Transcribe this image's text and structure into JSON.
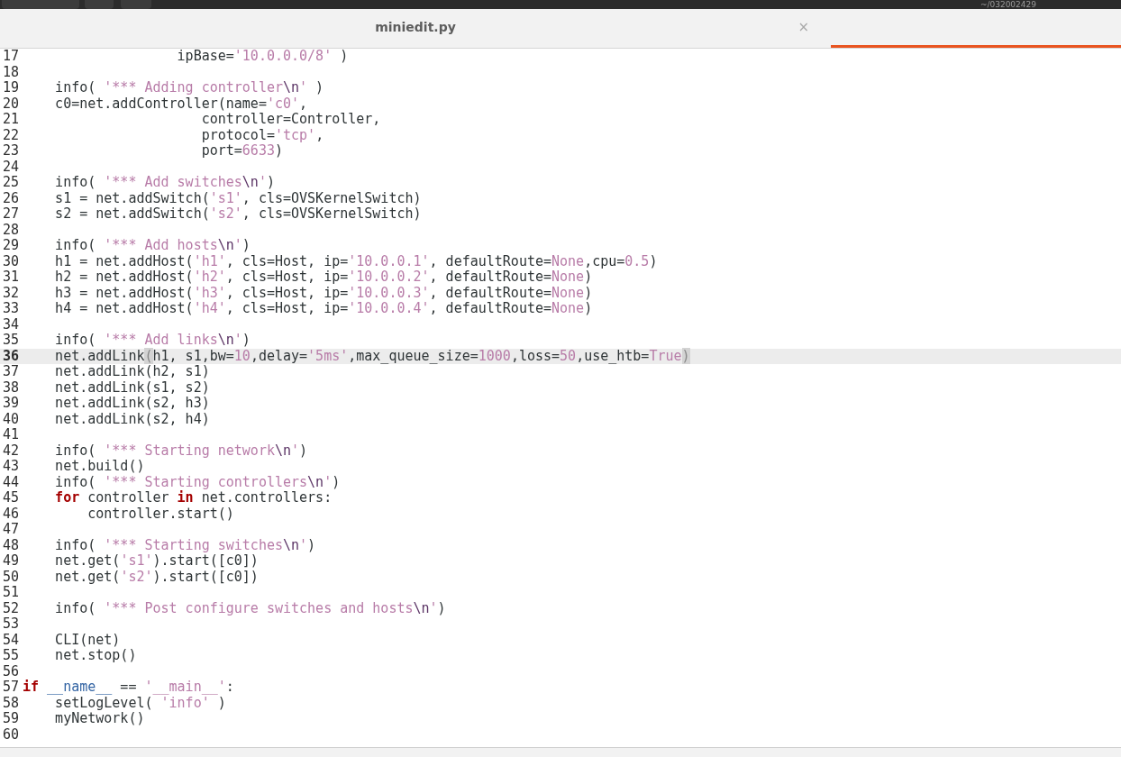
{
  "header": {
    "path": "~/032002429"
  },
  "tabs": [
    {
      "label": "miniedit.py",
      "selected": false,
      "close": "×"
    },
    {
      "selected": true
    }
  ],
  "lines": [
    {
      "number": "17",
      "current": false,
      "tokens": [
        {
          "kind": "plain",
          "text": "                   ipBase="
        },
        {
          "kind": "str",
          "text": "'10.0.0.0/8'"
        },
        {
          "kind": "plain",
          "text": " )"
        }
      ]
    },
    {
      "number": "18",
      "current": false
    },
    {
      "number": "19",
      "current": false,
      "tokens": [
        {
          "kind": "plain",
          "text": "    info( "
        },
        {
          "kind": "str",
          "text": "'*** Adding controller"
        },
        {
          "kind": "esc",
          "text": "\\n"
        },
        {
          "kind": "str",
          "text": "'"
        },
        {
          "kind": "plain",
          "text": " )"
        }
      ]
    },
    {
      "number": "20",
      "current": false,
      "tokens": [
        {
          "kind": "plain",
          "text": "    c0=net.addController(name="
        },
        {
          "kind": "str",
          "text": "'c0'"
        },
        {
          "kind": "plain",
          "text": ","
        }
      ]
    },
    {
      "number": "21",
      "current": false,
      "tokens": [
        {
          "kind": "plain",
          "text": "                      controller=Controller,"
        }
      ]
    },
    {
      "number": "22",
      "current": false,
      "tokens": [
        {
          "kind": "plain",
          "text": "                      protocol="
        },
        {
          "kind": "str",
          "text": "'tcp'"
        },
        {
          "kind": "plain",
          "text": ","
        }
      ]
    },
    {
      "number": "23",
      "current": false,
      "tokens": [
        {
          "kind": "plain",
          "text": "                      port="
        },
        {
          "kind": "num",
          "text": "6633"
        },
        {
          "kind": "plain",
          "text": ")"
        }
      ]
    },
    {
      "number": "24",
      "current": false
    },
    {
      "number": "25",
      "current": false,
      "tokens": [
        {
          "kind": "plain",
          "text": "    info( "
        },
        {
          "kind": "str",
          "text": "'*** Add switches"
        },
        {
          "kind": "esc",
          "text": "\\n"
        },
        {
          "kind": "str",
          "text": "'"
        },
        {
          "kind": "plain",
          "text": ")"
        }
      ]
    },
    {
      "number": "26",
      "current": false,
      "tokens": [
        {
          "kind": "plain",
          "text": "    s1 = net.addSwitch("
        },
        {
          "kind": "str",
          "text": "'s1'"
        },
        {
          "kind": "plain",
          "text": ", cls=OVSKernelSwitch)"
        }
      ]
    },
    {
      "number": "27",
      "current": false,
      "tokens": [
        {
          "kind": "plain",
          "text": "    s2 = net.addSwitch("
        },
        {
          "kind": "str",
          "text": "'s2'"
        },
        {
          "kind": "plain",
          "text": ", cls=OVSKernelSwitch)"
        }
      ]
    },
    {
      "number": "28",
      "current": false
    },
    {
      "number": "29",
      "current": false,
      "tokens": [
        {
          "kind": "plain",
          "text": "    info( "
        },
        {
          "kind": "str",
          "text": "'*** Add hosts"
        },
        {
          "kind": "esc",
          "text": "\\n"
        },
        {
          "kind": "str",
          "text": "'"
        },
        {
          "kind": "plain",
          "text": ")"
        }
      ]
    },
    {
      "number": "30",
      "current": false,
      "tokens": [
        {
          "kind": "plain",
          "text": "    h1 = net.addHost("
        },
        {
          "kind": "str",
          "text": "'h1'"
        },
        {
          "kind": "plain",
          "text": ", cls=Host, ip="
        },
        {
          "kind": "str",
          "text": "'10.0.0.1'"
        },
        {
          "kind": "plain",
          "text": ", defaultRoute="
        },
        {
          "kind": "num",
          "text": "None"
        },
        {
          "kind": "plain",
          "text": ",cpu="
        },
        {
          "kind": "num",
          "text": "0.5"
        },
        {
          "kind": "plain",
          "text": ")"
        }
      ]
    },
    {
      "number": "31",
      "current": false,
      "tokens": [
        {
          "kind": "plain",
          "text": "    h2 = net.addHost("
        },
        {
          "kind": "str",
          "text": "'h2'"
        },
        {
          "kind": "plain",
          "text": ", cls=Host, ip="
        },
        {
          "kind": "str",
          "text": "'10.0.0.2'"
        },
        {
          "kind": "plain",
          "text": ", defaultRoute="
        },
        {
          "kind": "num",
          "text": "None"
        },
        {
          "kind": "plain",
          "text": ")"
        }
      ]
    },
    {
      "number": "32",
      "current": false,
      "tokens": [
        {
          "kind": "plain",
          "text": "    h3 = net.addHost("
        },
        {
          "kind": "str",
          "text": "'h3'"
        },
        {
          "kind": "plain",
          "text": ", cls=Host, ip="
        },
        {
          "kind": "str",
          "text": "'10.0.0.3'"
        },
        {
          "kind": "plain",
          "text": ", defaultRoute="
        },
        {
          "kind": "num",
          "text": "None"
        },
        {
          "kind": "plain",
          "text": ")"
        }
      ]
    },
    {
      "number": "33",
      "current": false,
      "tokens": [
        {
          "kind": "plain",
          "text": "    h4 = net.addHost("
        },
        {
          "kind": "str",
          "text": "'h4'"
        },
        {
          "kind": "plain",
          "text": ", cls=Host, ip="
        },
        {
          "kind": "str",
          "text": "'10.0.0.4'"
        },
        {
          "kind": "plain",
          "text": ", defaultRoute="
        },
        {
          "kind": "num",
          "text": "None"
        },
        {
          "kind": "plain",
          "text": ")"
        }
      ]
    },
    {
      "number": "34",
      "current": false
    },
    {
      "number": "35",
      "current": false,
      "tokens": [
        {
          "kind": "plain",
          "text": "    info( "
        },
        {
          "kind": "str",
          "text": "'*** Add links"
        },
        {
          "kind": "esc",
          "text": "\\n"
        },
        {
          "kind": "str",
          "text": "'"
        },
        {
          "kind": "plain",
          "text": ")"
        }
      ]
    },
    {
      "number": "36",
      "current": true,
      "tokens": [
        {
          "kind": "plain",
          "text": "    net.addLink"
        },
        {
          "kind": "match",
          "text": "("
        },
        {
          "kind": "plain",
          "text": "h1, s1,bw="
        },
        {
          "kind": "num",
          "text": "10"
        },
        {
          "kind": "plain",
          "text": ",delay="
        },
        {
          "kind": "str",
          "text": "'5ms'"
        },
        {
          "kind": "plain",
          "text": ",max_queue_size="
        },
        {
          "kind": "num",
          "text": "1000"
        },
        {
          "kind": "plain",
          "text": ",loss="
        },
        {
          "kind": "num",
          "text": "50"
        },
        {
          "kind": "plain",
          "text": ",use_htb="
        },
        {
          "kind": "num",
          "text": "True"
        },
        {
          "kind": "match",
          "text": ")"
        }
      ]
    },
    {
      "number": "37",
      "current": false,
      "tokens": [
        {
          "kind": "plain",
          "text": "    net.addLink(h2, s1)"
        }
      ]
    },
    {
      "number": "38",
      "current": false,
      "tokens": [
        {
          "kind": "plain",
          "text": "    net.addLink(s1, s2)"
        }
      ]
    },
    {
      "number": "39",
      "current": false,
      "tokens": [
        {
          "kind": "plain",
          "text": "    net.addLink(s2, h3)"
        }
      ]
    },
    {
      "number": "40",
      "current": false,
      "tokens": [
        {
          "kind": "plain",
          "text": "    net.addLink(s2, h4)"
        }
      ]
    },
    {
      "number": "41",
      "current": false
    },
    {
      "number": "42",
      "current": false,
      "tokens": [
        {
          "kind": "plain",
          "text": "    info( "
        },
        {
          "kind": "str",
          "text": "'*** Starting network"
        },
        {
          "kind": "esc",
          "text": "\\n"
        },
        {
          "kind": "str",
          "text": "'"
        },
        {
          "kind": "plain",
          "text": ")"
        }
      ]
    },
    {
      "number": "43",
      "current": false,
      "tokens": [
        {
          "kind": "plain",
          "text": "    net.build()"
        }
      ]
    },
    {
      "number": "44",
      "current": false,
      "tokens": [
        {
          "kind": "plain",
          "text": "    info( "
        },
        {
          "kind": "str",
          "text": "'*** Starting controllers"
        },
        {
          "kind": "esc",
          "text": "\\n"
        },
        {
          "kind": "str",
          "text": "'"
        },
        {
          "kind": "plain",
          "text": ")"
        }
      ]
    },
    {
      "number": "45",
      "current": false,
      "indented": true,
      "tokens": [
        {
          "kind": "kw",
          "text": "for"
        },
        {
          "kind": "plain",
          "text": " controller "
        },
        {
          "kind": "kw",
          "text": "in"
        },
        {
          "kind": "plain",
          "text": " net.controllers:"
        }
      ]
    },
    {
      "number": "46",
      "current": false,
      "tokens": [
        {
          "kind": "plain",
          "text": "        controller.start()"
        }
      ]
    },
    {
      "number": "47",
      "current": false
    },
    {
      "number": "48",
      "current": false,
      "tokens": [
        {
          "kind": "plain",
          "text": "    info( "
        },
        {
          "kind": "str",
          "text": "'*** Starting switches"
        },
        {
          "kind": "esc",
          "text": "\\n"
        },
        {
          "kind": "str",
          "text": "'"
        },
        {
          "kind": "plain",
          "text": ")"
        }
      ]
    },
    {
      "number": "49",
      "current": false,
      "tokens": [
        {
          "kind": "plain",
          "text": "    net.get("
        },
        {
          "kind": "str",
          "text": "'s1'"
        },
        {
          "kind": "plain",
          "text": ").start([c0])"
        }
      ]
    },
    {
      "number": "50",
      "current": false,
      "tokens": [
        {
          "kind": "plain",
          "text": "    net.get("
        },
        {
          "kind": "str",
          "text": "'s2'"
        },
        {
          "kind": "plain",
          "text": ").start([c0])"
        }
      ]
    },
    {
      "number": "51",
      "current": false
    },
    {
      "number": "52",
      "current": false,
      "tokens": [
        {
          "kind": "plain",
          "text": "    info( "
        },
        {
          "kind": "str",
          "text": "'*** Post configure switches and hosts"
        },
        {
          "kind": "esc",
          "text": "\\n"
        },
        {
          "kind": "str",
          "text": "'"
        },
        {
          "kind": "plain",
          "text": ")"
        }
      ]
    },
    {
      "number": "53",
      "current": false
    },
    {
      "number": "54",
      "current": false,
      "tokens": [
        {
          "kind": "plain",
          "text": "    CLI(net)"
        }
      ]
    },
    {
      "number": "55",
      "current": false,
      "tokens": [
        {
          "kind": "plain",
          "text": "    net.stop()"
        }
      ]
    },
    {
      "number": "56",
      "current": false
    },
    {
      "number": "57",
      "current": false,
      "tokens": [
        {
          "kind": "kw",
          "text": "if "
        },
        {
          "kind": "name",
          "text": "__name__"
        },
        {
          "kind": "plain",
          "text": " == "
        },
        {
          "kind": "str",
          "text": "'__main__'"
        },
        {
          "kind": "plain",
          "text": ":"
        }
      ]
    },
    {
      "number": "58",
      "current": false,
      "tokens": [
        {
          "kind": "plain",
          "text": "    setLogLevel( "
        },
        {
          "kind": "str",
          "text": "'info'"
        },
        {
          "kind": "plain",
          "text": " )"
        }
      ]
    },
    {
      "number": "59",
      "current": false,
      "tokens": [
        {
          "kind": "plain",
          "text": "    myNetwork()"
        }
      ]
    },
    {
      "number": "60",
      "current": false
    }
  ]
}
